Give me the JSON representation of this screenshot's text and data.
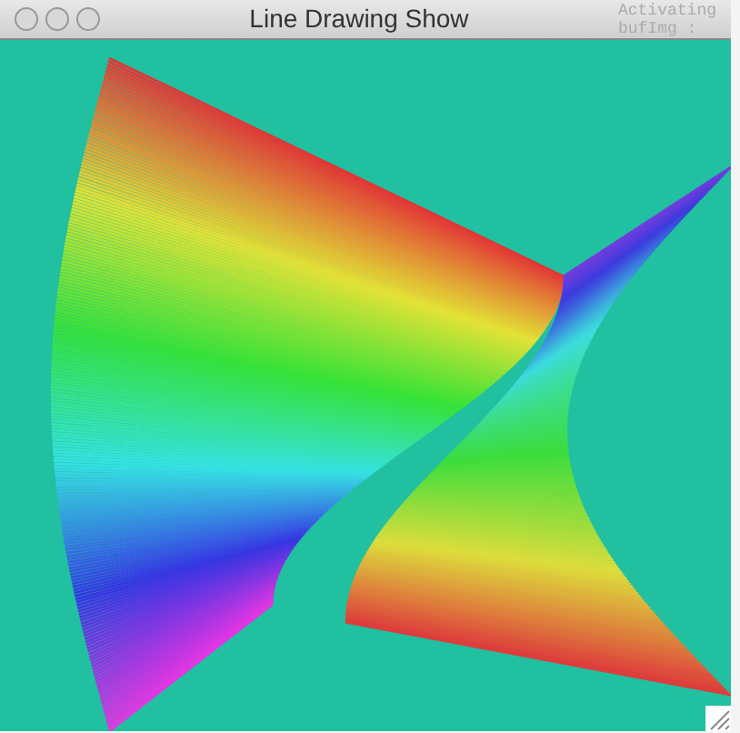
{
  "window": {
    "title": "Line Drawing Show"
  },
  "background_text": [
    "Activating",
    "bufImg :"
  ]
}
